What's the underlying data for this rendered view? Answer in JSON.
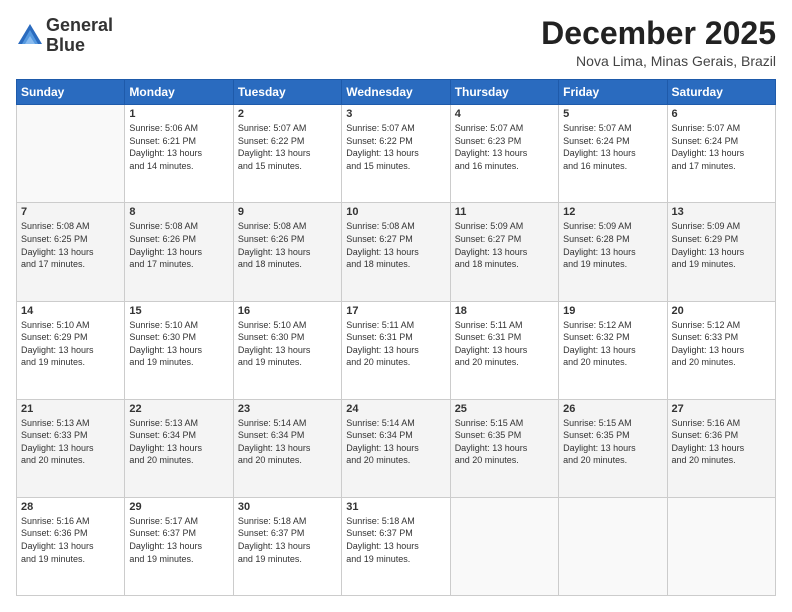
{
  "header": {
    "logo_line1": "General",
    "logo_line2": "Blue",
    "month": "December 2025",
    "location": "Nova Lima, Minas Gerais, Brazil"
  },
  "days_of_week": [
    "Sunday",
    "Monday",
    "Tuesday",
    "Wednesday",
    "Thursday",
    "Friday",
    "Saturday"
  ],
  "weeks": [
    [
      {
        "day": "",
        "info": ""
      },
      {
        "day": "1",
        "info": "Sunrise: 5:06 AM\nSunset: 6:21 PM\nDaylight: 13 hours\nand 14 minutes."
      },
      {
        "day": "2",
        "info": "Sunrise: 5:07 AM\nSunset: 6:22 PM\nDaylight: 13 hours\nand 15 minutes."
      },
      {
        "day": "3",
        "info": "Sunrise: 5:07 AM\nSunset: 6:22 PM\nDaylight: 13 hours\nand 15 minutes."
      },
      {
        "day": "4",
        "info": "Sunrise: 5:07 AM\nSunset: 6:23 PM\nDaylight: 13 hours\nand 16 minutes."
      },
      {
        "day": "5",
        "info": "Sunrise: 5:07 AM\nSunset: 6:24 PM\nDaylight: 13 hours\nand 16 minutes."
      },
      {
        "day": "6",
        "info": "Sunrise: 5:07 AM\nSunset: 6:24 PM\nDaylight: 13 hours\nand 17 minutes."
      }
    ],
    [
      {
        "day": "7",
        "info": "Sunrise: 5:08 AM\nSunset: 6:25 PM\nDaylight: 13 hours\nand 17 minutes."
      },
      {
        "day": "8",
        "info": "Sunrise: 5:08 AM\nSunset: 6:26 PM\nDaylight: 13 hours\nand 17 minutes."
      },
      {
        "day": "9",
        "info": "Sunrise: 5:08 AM\nSunset: 6:26 PM\nDaylight: 13 hours\nand 18 minutes."
      },
      {
        "day": "10",
        "info": "Sunrise: 5:08 AM\nSunset: 6:27 PM\nDaylight: 13 hours\nand 18 minutes."
      },
      {
        "day": "11",
        "info": "Sunrise: 5:09 AM\nSunset: 6:27 PM\nDaylight: 13 hours\nand 18 minutes."
      },
      {
        "day": "12",
        "info": "Sunrise: 5:09 AM\nSunset: 6:28 PM\nDaylight: 13 hours\nand 19 minutes."
      },
      {
        "day": "13",
        "info": "Sunrise: 5:09 AM\nSunset: 6:29 PM\nDaylight: 13 hours\nand 19 minutes."
      }
    ],
    [
      {
        "day": "14",
        "info": "Sunrise: 5:10 AM\nSunset: 6:29 PM\nDaylight: 13 hours\nand 19 minutes."
      },
      {
        "day": "15",
        "info": "Sunrise: 5:10 AM\nSunset: 6:30 PM\nDaylight: 13 hours\nand 19 minutes."
      },
      {
        "day": "16",
        "info": "Sunrise: 5:10 AM\nSunset: 6:30 PM\nDaylight: 13 hours\nand 19 minutes."
      },
      {
        "day": "17",
        "info": "Sunrise: 5:11 AM\nSunset: 6:31 PM\nDaylight: 13 hours\nand 20 minutes."
      },
      {
        "day": "18",
        "info": "Sunrise: 5:11 AM\nSunset: 6:31 PM\nDaylight: 13 hours\nand 20 minutes."
      },
      {
        "day": "19",
        "info": "Sunrise: 5:12 AM\nSunset: 6:32 PM\nDaylight: 13 hours\nand 20 minutes."
      },
      {
        "day": "20",
        "info": "Sunrise: 5:12 AM\nSunset: 6:33 PM\nDaylight: 13 hours\nand 20 minutes."
      }
    ],
    [
      {
        "day": "21",
        "info": "Sunrise: 5:13 AM\nSunset: 6:33 PM\nDaylight: 13 hours\nand 20 minutes."
      },
      {
        "day": "22",
        "info": "Sunrise: 5:13 AM\nSunset: 6:34 PM\nDaylight: 13 hours\nand 20 minutes."
      },
      {
        "day": "23",
        "info": "Sunrise: 5:14 AM\nSunset: 6:34 PM\nDaylight: 13 hours\nand 20 minutes."
      },
      {
        "day": "24",
        "info": "Sunrise: 5:14 AM\nSunset: 6:34 PM\nDaylight: 13 hours\nand 20 minutes."
      },
      {
        "day": "25",
        "info": "Sunrise: 5:15 AM\nSunset: 6:35 PM\nDaylight: 13 hours\nand 20 minutes."
      },
      {
        "day": "26",
        "info": "Sunrise: 5:15 AM\nSunset: 6:35 PM\nDaylight: 13 hours\nand 20 minutes."
      },
      {
        "day": "27",
        "info": "Sunrise: 5:16 AM\nSunset: 6:36 PM\nDaylight: 13 hours\nand 20 minutes."
      }
    ],
    [
      {
        "day": "28",
        "info": "Sunrise: 5:16 AM\nSunset: 6:36 PM\nDaylight: 13 hours\nand 19 minutes."
      },
      {
        "day": "29",
        "info": "Sunrise: 5:17 AM\nSunset: 6:37 PM\nDaylight: 13 hours\nand 19 minutes."
      },
      {
        "day": "30",
        "info": "Sunrise: 5:18 AM\nSunset: 6:37 PM\nDaylight: 13 hours\nand 19 minutes."
      },
      {
        "day": "31",
        "info": "Sunrise: 5:18 AM\nSunset: 6:37 PM\nDaylight: 13 hours\nand 19 minutes."
      },
      {
        "day": "",
        "info": ""
      },
      {
        "day": "",
        "info": ""
      },
      {
        "day": "",
        "info": ""
      }
    ]
  ]
}
